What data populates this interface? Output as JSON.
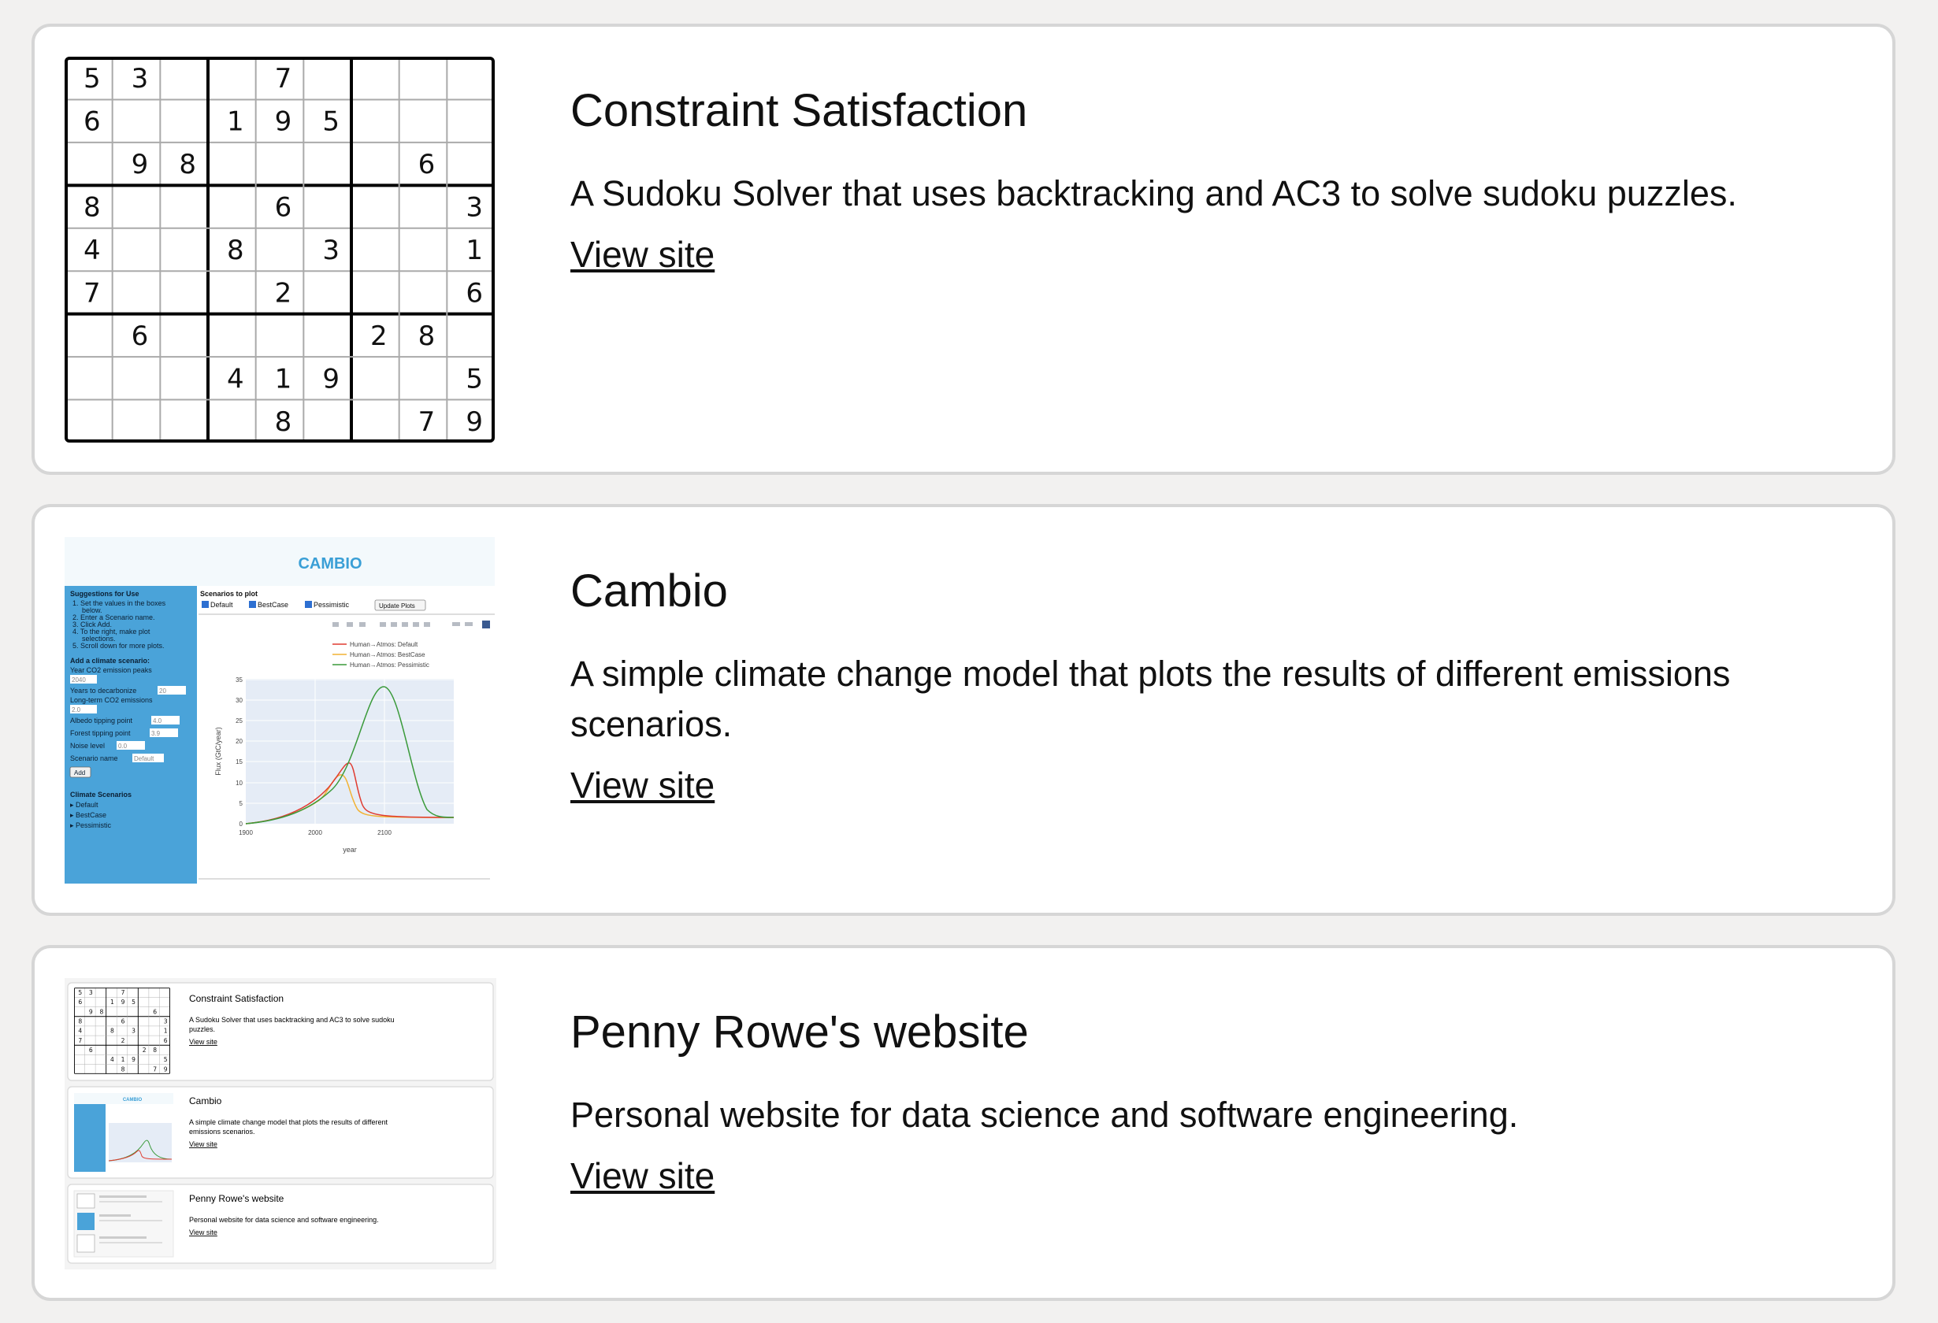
{
  "projects": [
    {
      "title": "Constraint Satisfaction",
      "description": "A Sudoku Solver that uses backtracking and AC3 to solve sudoku puzzles.",
      "link_label": "View site",
      "thumbnail": "sudoku-board",
      "sudoku": [
        [
          5,
          3,
          0,
          0,
          7,
          0,
          0,
          0,
          0
        ],
        [
          6,
          0,
          0,
          1,
          9,
          5,
          0,
          0,
          0
        ],
        [
          0,
          9,
          8,
          0,
          0,
          0,
          0,
          6,
          0
        ],
        [
          8,
          0,
          0,
          0,
          6,
          0,
          0,
          0,
          3
        ],
        [
          4,
          0,
          0,
          8,
          0,
          3,
          0,
          0,
          1
        ],
        [
          7,
          0,
          0,
          0,
          2,
          0,
          0,
          0,
          6
        ],
        [
          0,
          6,
          0,
          0,
          0,
          0,
          2,
          8,
          0
        ],
        [
          0,
          0,
          0,
          4,
          1,
          9,
          0,
          0,
          5
        ],
        [
          0,
          0,
          0,
          0,
          8,
          0,
          0,
          7,
          9
        ]
      ]
    },
    {
      "title": "Cambio",
      "description": "A simple climate change model that plots the results of different emissions scenarios.",
      "link_label": "View site",
      "thumbnail": "cambio-app-screenshot",
      "app": {
        "header": "CAMBIO",
        "suggestions_title": "Suggestions for Use",
        "suggestions": [
          "1. Set the values in the boxes",
          "below.",
          "2. Enter a Scenario name.",
          "3. Click Add.",
          "4. To the right, make plot",
          "selections.",
          "5. Scroll down for more plots."
        ],
        "add_title": "Add a climate scenario:",
        "fields": [
          {
            "label": "Year CO2 emission peaks",
            "value": "2040"
          },
          {
            "label": "Years to decarbonize",
            "value": "20"
          },
          {
            "label": "Long-term CO2 emissions",
            "value": "2.0"
          },
          {
            "label": "Albedo tipping point",
            "value": "4.0"
          },
          {
            "label": "Forest tipping point",
            "value": "3.9"
          },
          {
            "label": "Noise level",
            "value": "0.0"
          },
          {
            "label": "Scenario name",
            "value": "Default"
          }
        ],
        "add_button": "Add",
        "scenarios_title": "Climate Scenarios",
        "scenarios": [
          "▸ Default",
          "▸ BestCase",
          "▸ Pessimistic"
        ],
        "plot_title": "Scenarios to plot",
        "checkboxes": [
          "Default",
          "BestCase",
          "Pessimistic"
        ],
        "update_button": "Update Plots",
        "legend": [
          "Human→Atmos: Default",
          "Human→Atmos: BestCase",
          "Human→Atmos: Pessimistic"
        ],
        "colors": {
          "default": "#e03c31",
          "bestcase": "#f2b233",
          "pessimistic": "#3a9a3a",
          "sidebar": "#4aa3d9",
          "header": "#3a9fd6"
        },
        "ylabel": "Flux  (GtC/year)",
        "xlabel": "year",
        "yticks": [
          "35",
          "30",
          "25",
          "20",
          "15",
          "10",
          "5",
          "0"
        ],
        "xticks": [
          "1900",
          "2000",
          "2100"
        ]
      }
    },
    {
      "title": "Penny Rowe's website",
      "description": "Personal website for data science and software engineering.",
      "link_label": "View site",
      "thumbnail": "website-preview",
      "preview": {
        "cards": [
          {
            "title": "Constraint Satisfaction",
            "line1": "A Sudoku Solver that uses backtracking and AC3 to solve sudoku",
            "line2": "puzzles.",
            "link": "View site"
          },
          {
            "title": "Cambio",
            "line1": "A simple climate change model that plots the results of different",
            "line2": "emissions scenarios.",
            "link": "View site"
          },
          {
            "title": "Penny Rowe's website",
            "line1": "Personal website for data science and software engineering.",
            "line2": "",
            "link": "View site"
          }
        ]
      }
    }
  ]
}
